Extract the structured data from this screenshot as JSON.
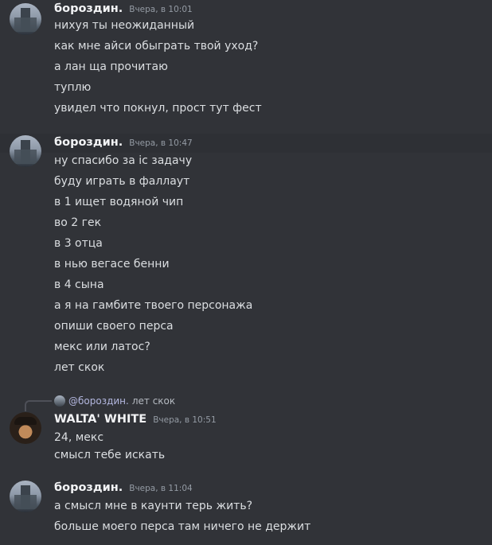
{
  "groups": [
    {
      "author": "бороздин.",
      "timestamp": "Вчера, в 10:01",
      "avatar": "castle-avatar",
      "messages": [
        "нихуя ты неожиданный",
        "как мне айси обыграть твой уход?",
        "а лан ща прочитаю",
        "туплю",
        "увидел что покнул, прост тут фест"
      ]
    },
    {
      "author": "бороздин.",
      "timestamp": "Вчера, в 10:47",
      "avatar": "castle-avatar",
      "messages": [
        "ну спасибо за іс задачу",
        "буду играть в фаллаут",
        "в 1 ищет водяной чип",
        "во 2 гек",
        "в 3 отца",
        "в нью вегасе бенни",
        "в 4 сына",
        "а я на гамбите твоего персонажа",
        "опиши своего перса",
        "мекс или латос?",
        "лет скок"
      ]
    },
    {
      "reply": {
        "name": "@бороздин.",
        "text": "лет скок"
      },
      "author": "WALTA' WHITE",
      "timestamp": "Вчера, в 10:51",
      "avatar": "walt-avatar",
      "messages": [
        "24, мекс",
        "смысл тебе искать"
      ]
    },
    {
      "author": "бороздин.",
      "timestamp": "Вчера, в 11:04",
      "avatar": "castle-avatar",
      "messages": [
        "а смысл мне в каунти терь жить?",
        "больше моего перса там ничего не держит"
      ]
    }
  ],
  "colors": {
    "background": "#313338",
    "author": "#f2f3f5",
    "text": "#dbdee1",
    "timestamp": "#949ba4"
  }
}
